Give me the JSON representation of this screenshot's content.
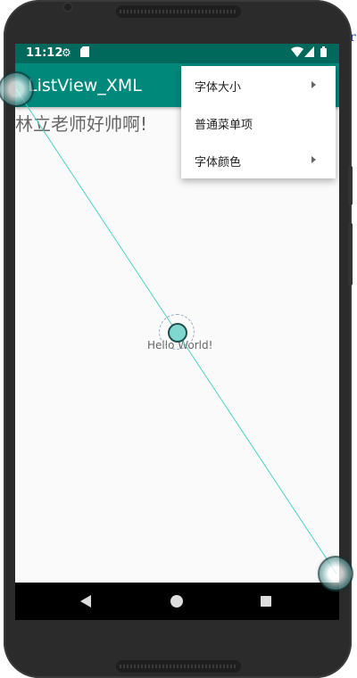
{
  "status_bar": {
    "time": "11:12",
    "gear_icon": "gear-icon",
    "sd_icon": "sd-card-icon",
    "wifi_icon": "wifi-icon",
    "signal_icon": "signal-icon",
    "battery_icon": "battery-icon"
  },
  "app_bar": {
    "title": "ListView_XML"
  },
  "content": {
    "main_text": "林立老师好帅啊!",
    "hello_text": "Hello World!"
  },
  "menu": {
    "items": [
      {
        "label": "字体大小",
        "has_submenu": true
      },
      {
        "label": "普通菜单项",
        "has_submenu": false
      },
      {
        "label": "字体颜色",
        "has_submenu": true
      }
    ]
  },
  "nav_bar": {
    "back_icon": "back-triangle-icon",
    "home_icon": "home-circle-icon",
    "recents_icon": "recents-square-icon"
  },
  "colors": {
    "status_bar": "#00695c",
    "app_bar": "#00897b",
    "screen_bg": "#fafafa",
    "gesture_line": "#4dd0c4"
  }
}
